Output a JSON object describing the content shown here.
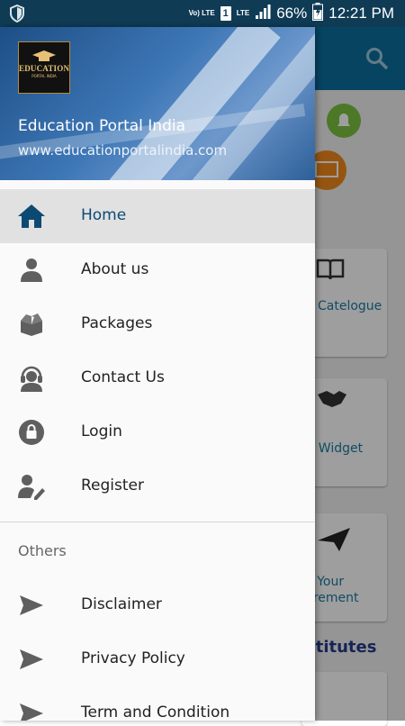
{
  "status_bar": {
    "volte": "Vo) LTE",
    "sim": "1",
    "lte": "LTE",
    "battery": "66%",
    "time": "12:21 PM"
  },
  "background_app": {
    "cards": [
      "Catelogue",
      "ar Widget",
      "st Your",
      "uirement"
    ],
    "section_heading": "stitutes"
  },
  "drawer": {
    "logo": {
      "text": "EDUCATION",
      "sub": "PORTAL INDIA"
    },
    "title": "Education Portal India",
    "url": "www.educationportalindia.com",
    "menu": [
      {
        "label": "Home",
        "icon": "home-icon"
      },
      {
        "label": "About us",
        "icon": "person-icon"
      },
      {
        "label": "Packages",
        "icon": "box-icon"
      },
      {
        "label": "Contact Us",
        "icon": "headset-icon"
      },
      {
        "label": "Login",
        "icon": "lock-icon"
      },
      {
        "label": "Register",
        "icon": "user-edit-icon"
      }
    ],
    "section_title": "Others",
    "others": [
      {
        "label": "Disclaimer",
        "icon": "send-icon"
      },
      {
        "label": "Privacy Policy",
        "icon": "send-icon"
      },
      {
        "label": "Term and Condition",
        "icon": "send-icon"
      }
    ]
  },
  "colors": {
    "status_bar": "#0f3b55",
    "app_bar": "#0b6f9e",
    "active_item_bg": "#e1e1e1",
    "active_text": "#0c4a74",
    "icon_gray": "#5f5f5f"
  }
}
